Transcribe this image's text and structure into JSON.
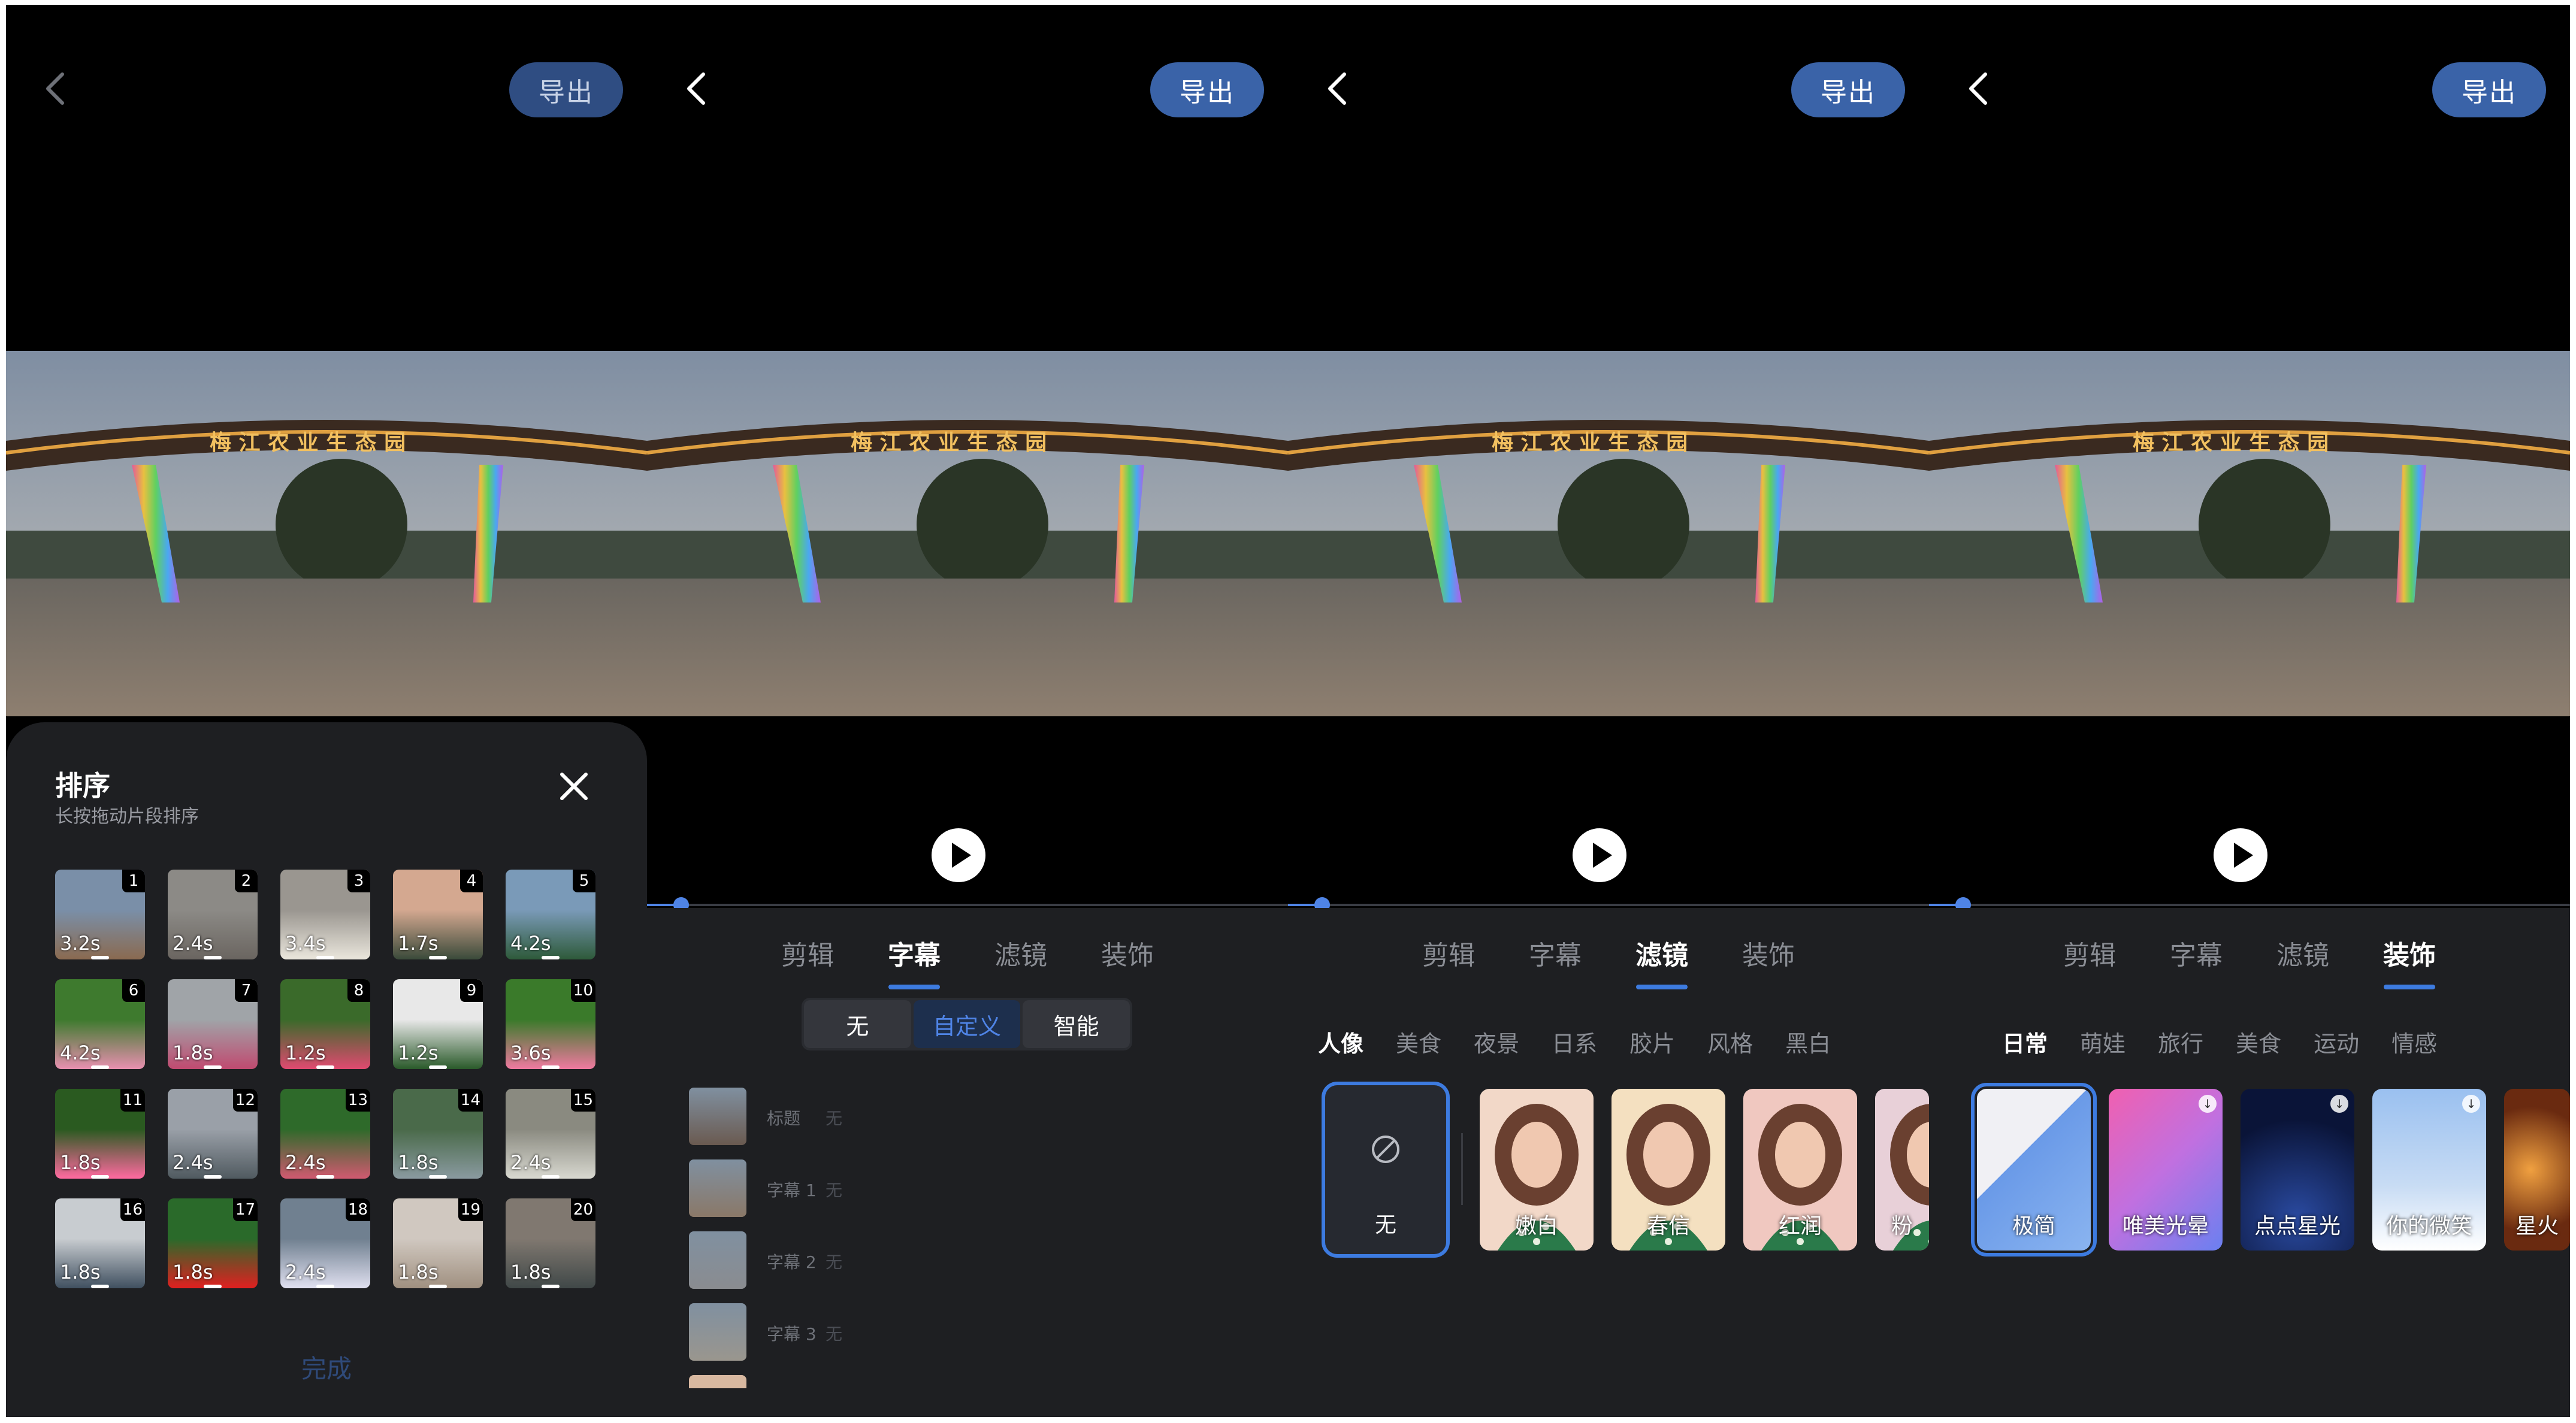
{
  "common": {
    "export_label": "导出",
    "tabs": [
      "剪辑",
      "字幕",
      "滤镜",
      "装饰"
    ]
  },
  "sort_sheet": {
    "title": "排序",
    "subtitle": "长按拖动片段排序",
    "done_label": "完成",
    "clips": [
      {
        "num": "1",
        "dur": "3.2s"
      },
      {
        "num": "2",
        "dur": "2.4s"
      },
      {
        "num": "3",
        "dur": "3.4s"
      },
      {
        "num": "4",
        "dur": "1.7s"
      },
      {
        "num": "5",
        "dur": "4.2s"
      },
      {
        "num": "6",
        "dur": "4.2s"
      },
      {
        "num": "7",
        "dur": "1.8s"
      },
      {
        "num": "8",
        "dur": "1.2s"
      },
      {
        "num": "9",
        "dur": "1.2s"
      },
      {
        "num": "10",
        "dur": "3.6s"
      },
      {
        "num": "11",
        "dur": "1.8s"
      },
      {
        "num": "12",
        "dur": "2.4s"
      },
      {
        "num": "13",
        "dur": "2.4s"
      },
      {
        "num": "14",
        "dur": "1.8s"
      },
      {
        "num": "15",
        "dur": "2.4s"
      },
      {
        "num": "16",
        "dur": "1.8s"
      },
      {
        "num": "17",
        "dur": "1.8s"
      },
      {
        "num": "18",
        "dur": "2.4s"
      },
      {
        "num": "19",
        "dur": "1.8s"
      },
      {
        "num": "20",
        "dur": "1.8s"
      }
    ]
  },
  "subtitle_panel": {
    "modes": [
      "无",
      "自定义",
      "智能"
    ],
    "active_mode": "自定义",
    "rows": [
      {
        "label": "标题",
        "value": "无"
      },
      {
        "label": "字幕 1",
        "value": "无"
      },
      {
        "label": "字幕 2",
        "value": "无"
      },
      {
        "label": "字幕 3",
        "value": "无"
      }
    ]
  },
  "filter_panel": {
    "categories": [
      "人像",
      "美食",
      "夜景",
      "日系",
      "胶片",
      "风格",
      "黑白"
    ],
    "none_label": "无",
    "filters": [
      "嫩白",
      "春信",
      "红润",
      "粉"
    ]
  },
  "deco_panel": {
    "categories": [
      "日常",
      "萌娃",
      "旅行",
      "美食",
      "运动",
      "情感"
    ],
    "items": [
      "极简",
      "唯美光晕",
      "点点星光",
      "你的微笑",
      "星火"
    ]
  },
  "colors": {
    "accent": "#3d7be0",
    "export_bg": "#3a63a8",
    "panel_bg": "#1e1f22"
  }
}
